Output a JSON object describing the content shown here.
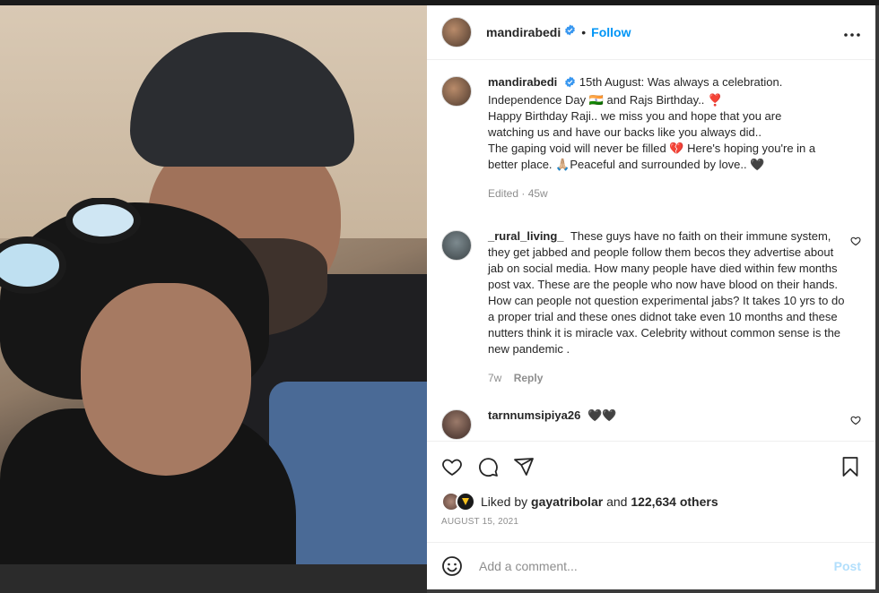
{
  "post": {
    "username": "mandirabedi",
    "follow_label": "Follow",
    "dot": "•",
    "more_label": "•••"
  },
  "caption": {
    "username": "mandirabedi",
    "lines": [
      "15th August: Was always a celebration.",
      "Independence Day 🇮🇳 and Rajs Birthday.. ❣️",
      "Happy Birthday Raji.. we miss you and hope that you are",
      "watching us and have our backs like you always did..",
      "The gaping void will never be filled 💔 Here's hoping you're in a",
      "better place. 🙏🏼Peaceful and surrounded by love.. 🖤"
    ],
    "meta": "Edited · 45w"
  },
  "comments": [
    {
      "username": "_rural_living_",
      "text": "These guys have no faith on their immune system, they get jabbed and people follow them becos they advertise about jab on social media. How many people have died within few months post vax. These are the people who now have blood on their hands. How can people not question experimental jabs? It takes 10 yrs to do a proper trial and these ones didnot take even 10 months and these nutters think it is miracle vax. Celebrity without common sense is the new pandemic .",
      "time": "7w",
      "reply_label": "Reply"
    },
    {
      "username": "tarnnumsipiya26",
      "text": "🖤🖤",
      "time": "",
      "reply_label": ""
    }
  ],
  "likes": {
    "prefix": "Liked by",
    "first_user": "gayatribolar",
    "middle": "and",
    "others": "122,634 others"
  },
  "date": "AUGUST 15, 2021",
  "add_comment": {
    "placeholder": "Add a comment...",
    "post_label": "Post"
  },
  "icons": {
    "heart": "heart-icon",
    "comment": "comment-icon",
    "share": "share-icon",
    "save": "bookmark-icon",
    "emoji": "emoji-icon",
    "verified": "verified-badge-icon"
  },
  "colors": {
    "link_blue": "#0095f6",
    "post_disabled": "#b2dffc",
    "muted": "#8e8e8e",
    "text": "#262626"
  }
}
